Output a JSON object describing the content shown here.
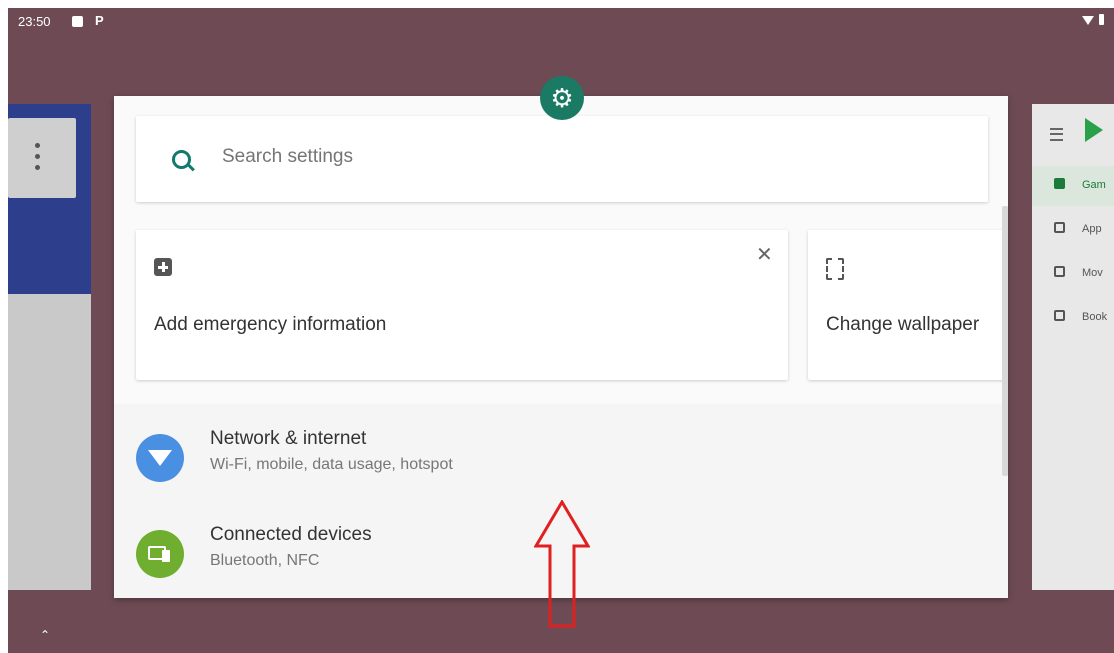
{
  "status_bar": {
    "time": "23:50",
    "right_icons": [
      "wifi-icon",
      "battery-icon"
    ],
    "left_icons": [
      "image-notification-icon",
      "p-notification-icon"
    ]
  },
  "settings": {
    "search": {
      "placeholder": "Search settings"
    },
    "suggestions": [
      {
        "title": "Add emergency information",
        "icon": "plus-box-icon",
        "dismiss": "✕"
      },
      {
        "title": "Change wallpaper",
        "icon": "wallpaper-icon"
      }
    ],
    "items": [
      {
        "title": "Network & internet",
        "subtitle": "Wi‑Fi, mobile, data usage, hotspot",
        "icon": "wifi-icon",
        "color": "#4a90e2"
      },
      {
        "title": "Connected devices",
        "subtitle": "Bluetooth, NFC",
        "icon": "devices-icon",
        "color": "#6fae2f"
      }
    ],
    "app_icon": "gear-icon",
    "accent": "#1a7a63"
  },
  "right_app": {
    "items": [
      {
        "label": "Gam",
        "active": true
      },
      {
        "label": "App",
        "active": false
      },
      {
        "label": "Mov",
        "active": false
      },
      {
        "label": "Book",
        "active": false
      }
    ]
  },
  "colors": {
    "background": "#6e4b54",
    "annotation_arrow": "#e02020"
  }
}
